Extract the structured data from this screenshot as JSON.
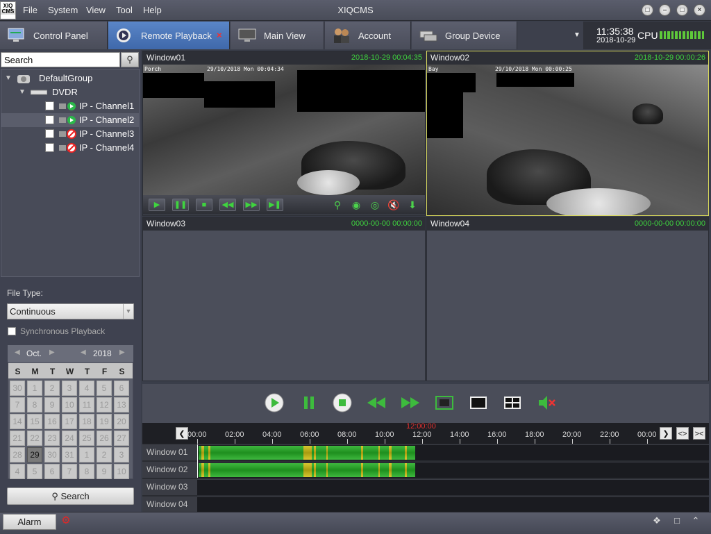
{
  "app": {
    "title": "XIQCMS",
    "logo_text": [
      "XIQ",
      "CMS"
    ]
  },
  "menu": [
    "File",
    "System",
    "View",
    "Tool",
    "Help"
  ],
  "window_buttons": [
    "lock-icon",
    "minimize-icon",
    "restore-icon",
    "close-icon"
  ],
  "tabs": [
    {
      "label": "Control Panel",
      "icon": "control-panel-icon",
      "active": false
    },
    {
      "label": "Remote Playback",
      "icon": "playback-icon",
      "active": true,
      "closable": true
    },
    {
      "label": "Main View",
      "icon": "monitor-icon",
      "active": false
    },
    {
      "label": "Account",
      "icon": "users-icon",
      "active": false
    },
    {
      "label": "Group Device",
      "icon": "group-device-icon",
      "active": false
    }
  ],
  "status": {
    "time": "11:35:38",
    "date": "2018-10-29",
    "cpu_label": "CPU",
    "cpu_level": 1.0
  },
  "sidebar": {
    "search_placeholder": "Search",
    "tree": [
      {
        "label": "DefaultGroup",
        "level": 0,
        "expanded": true,
        "icon": "group-camera-icon"
      },
      {
        "label": "DVDR",
        "level": 1,
        "expanded": true,
        "icon": "dvr-icon"
      },
      {
        "label": "IP - Channel1",
        "level": 2,
        "status": "online",
        "checked": false
      },
      {
        "label": "IP - Channel2",
        "level": 2,
        "status": "online",
        "checked": false,
        "selected": true
      },
      {
        "label": "IP - Channel3",
        "level": 2,
        "status": "offline",
        "checked": false
      },
      {
        "label": "IP - Channel4",
        "level": 2,
        "status": "offline",
        "checked": false
      }
    ],
    "file_type_label": "File Type:",
    "file_type_value": "Continuous",
    "sync_label": "Synchronous Playback",
    "sync_checked": false,
    "calendar": {
      "month": "Oct.",
      "year": "2018",
      "weekdays": [
        "S",
        "M",
        "T",
        "W",
        "T",
        "F",
        "S"
      ],
      "days": [
        [
          "30",
          "1",
          "2",
          "3",
          "4",
          "5",
          "6"
        ],
        [
          "7",
          "8",
          "9",
          "10",
          "11",
          "12",
          "13"
        ],
        [
          "14",
          "15",
          "16",
          "17",
          "18",
          "19",
          "20"
        ],
        [
          "21",
          "22",
          "23",
          "24",
          "25",
          "26",
          "27"
        ],
        [
          "28",
          "29",
          "30",
          "31",
          "1",
          "2",
          "3"
        ],
        [
          "4",
          "5",
          "6",
          "7",
          "8",
          "9",
          "10"
        ]
      ],
      "selected_day": "29"
    },
    "search_button": "Search"
  },
  "windows": [
    {
      "name": "Window01",
      "time": "2018-10-29 00:04:35",
      "osd_left": "Porch",
      "osd_right": "29/10/2018 Mon 00:04:34",
      "has_video": true,
      "focused": false
    },
    {
      "name": "Window02",
      "time": "2018-10-29 00:00:26",
      "osd_left": "Bay",
      "osd_right": "29/10/2018 Mon 00:00:25",
      "has_video": true,
      "focused": true
    },
    {
      "name": "Window03",
      "time": "0000-00-00 00:00:00",
      "has_video": false
    },
    {
      "name": "Window04",
      "time": "0000-00-00 00:00:00",
      "has_video": false
    }
  ],
  "timeline": {
    "current_time": "12:00:00",
    "hours": [
      "00:00",
      "02:00",
      "04:00",
      "06:00",
      "08:00",
      "10:00",
      "12:00",
      "14:00",
      "16:00",
      "18:00",
      "20:00",
      "22:00",
      "00:00"
    ],
    "rows": [
      {
        "label": "Window 01",
        "has_records": true
      },
      {
        "label": "Window 02",
        "has_records": true
      },
      {
        "label": "Window 03",
        "has_records": false
      },
      {
        "label": "Window 04",
        "has_records": false
      }
    ]
  },
  "statusbar": {
    "alarm_label": "Alarm"
  },
  "colors": {
    "accent": "#4a78bd",
    "record_green": "#2ea82e",
    "record_yellow": "#c8b820",
    "time_green": "#3ed33e",
    "focus_border": "#d9d95a"
  }
}
